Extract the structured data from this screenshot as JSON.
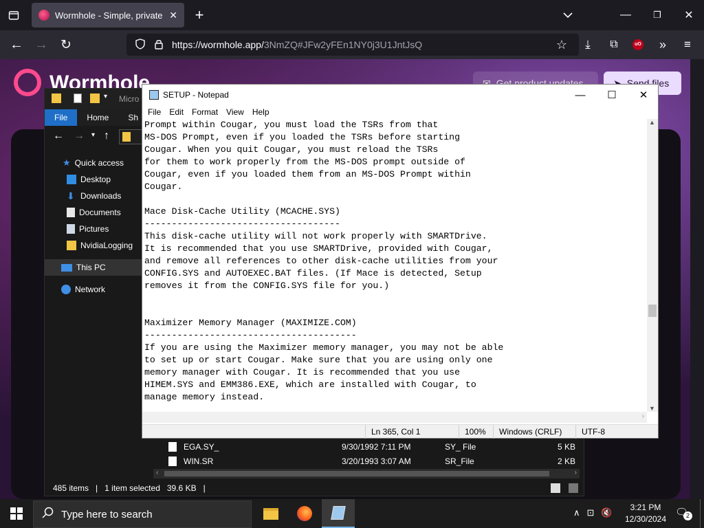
{
  "browser": {
    "tab_title": "Wormhole - Simple, private file",
    "url_host": "https://wormhole.app/",
    "url_path": "3NmZQ#JFw2yFEn1NY0j3U1JntJsQ"
  },
  "webpage": {
    "brand": "Wormhole",
    "updates_button": "Get product updates",
    "send_button": "Send files"
  },
  "explorer": {
    "title_fragment": "Micro",
    "ribbon_tabs": [
      "File",
      "Home",
      "Sh"
    ],
    "nav_items": [
      {
        "label": "Quick access"
      },
      {
        "label": "Desktop"
      },
      {
        "label": "Downloads"
      },
      {
        "label": "Documents"
      },
      {
        "label": "Pictures"
      },
      {
        "label": "NvidiaLogging"
      },
      {
        "label": "This PC"
      },
      {
        "label": "Network"
      }
    ],
    "files": [
      {
        "name": "EGA.SY_",
        "date": "9/30/1992 7:11 PM",
        "type": "SY_ File",
        "size": "5 KB"
      },
      {
        "name": "WIN.SR",
        "date": "3/20/1993 3:07 AM",
        "type": "SR_File",
        "size": "2 KB"
      }
    ],
    "status": {
      "items": "485 items",
      "selected": "1 item selected",
      "size": "39.6 KB"
    }
  },
  "notepad": {
    "title": "SETUP - Notepad",
    "menu": [
      "File",
      "Edit",
      "Format",
      "View",
      "Help"
    ],
    "text": "Prompt within Cougar, you must load the TSRs from that\nMS-DOS Prompt, even if you loaded the TSRs before starting\nCougar. When you quit Cougar, you must reload the TSRs\nfor them to work properly from the MS-DOS prompt outside of\nCougar, even if you loaded them from an MS-DOS Prompt within\nCougar.\n\nMace Disk-Cache Utility (MCACHE.SYS)\n------------------------------------\nThis disk-cache utility will not work properly with SMARTDrive.\nIt is recommended that you use SMARTDrive, provided with Cougar,\nand remove all references to other disk-cache utilities from your\nCONFIG.SYS and AUTOEXEC.BAT files. (If Mace is detected, Setup\nremoves it from the CONFIG.SYS file for you.)\n\n\nMaximizer Memory Manager (MAXIMIZE.COM)\n---------------------------------------\nIf you are using the Maximizer memory manager, you may not be able\nto set up or start Cougar. Make sure that you are using only one\nmemory manager with Cougar. It is recommended that you use\nHIMEM.SYS and EMM386.EXE, which are installed with Cougar, to\nmanage memory instead.",
    "status": {
      "position": "Ln 365, Col 1",
      "zoom": "100%",
      "line_ending": "Windows (CRLF)",
      "encoding": "UTF-8"
    }
  },
  "taskbar": {
    "search_placeholder": "Type here to search",
    "time": "3:21 PM",
    "date": "12/30/2024",
    "notification_count": "2"
  }
}
